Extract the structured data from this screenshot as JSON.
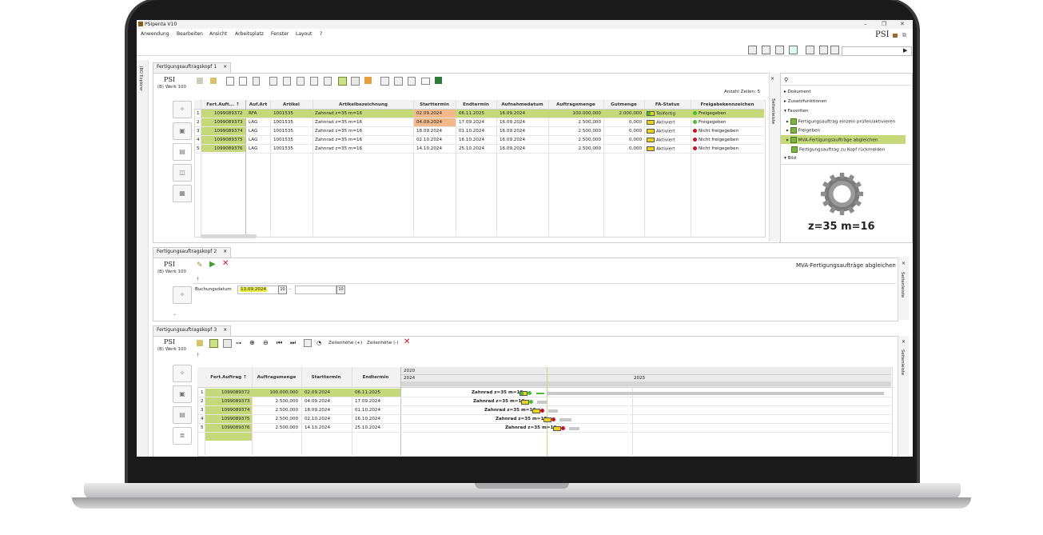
{
  "app": {
    "title": "PSIpenta V10",
    "logo": "PSI",
    "menu": [
      "Anwendung",
      "Bearbeiten",
      "Ansicht",
      "Arbeitsplatz",
      "Fenster",
      "Layout",
      "?"
    ],
    "ibo_label": "IBO Explorer"
  },
  "panel1": {
    "tab": "Fertigungsauftragskopf 1",
    "tab_close": "×",
    "psi": "PSI",
    "werk": "(B) Werk 100",
    "row_count": "Anzahl Zeilen: 5",
    "columns": [
      "Fert.Auft...",
      "Auf.Art",
      "Artikel",
      "Artikelbezeichnung",
      "Starttermin",
      "Endtermin",
      "Aufnahmedatum",
      "Auftragsmenge",
      "Gutmenge",
      "FA-Status",
      "Freigabekennzeichen"
    ],
    "sort_arrow": "↑",
    "rows": [
      {
        "n": "1",
        "auftrag": "1099089372",
        "art": "RFA",
        "artikel": "1001535",
        "bez": "Zahnrad z=35 m=16",
        "start": "02.09.2024",
        "ende": "06.11.2025",
        "aufnahme": "16.09.2024",
        "menge": "100.000,000",
        "gut": "2.000,000",
        "status": "Teilfertig",
        "freigabe": "Freigegeben",
        "freigabe_color": "green"
      },
      {
        "n": "2",
        "auftrag": "1099089373",
        "art": "LAG",
        "artikel": "1001535",
        "bez": "Zahnrad z=35 m=16",
        "start": "04.09.2024",
        "ende": "17.09.2024",
        "aufnahme": "16.09.2024",
        "menge": "2.500,000",
        "gut": "0,000",
        "status": "Aktiviert",
        "freigabe": "Freigegeben",
        "freigabe_color": "green"
      },
      {
        "n": "3",
        "auftrag": "1099089374",
        "art": "LAG",
        "artikel": "1001535",
        "bez": "Zahnrad z=35 m=16",
        "start": "18.09.2024",
        "ende": "01.10.2024",
        "aufnahme": "16.09.2024",
        "menge": "2.500,000",
        "gut": "0,000",
        "status": "Aktiviert",
        "freigabe": "Nicht freigegeben",
        "freigabe_color": "red"
      },
      {
        "n": "4",
        "auftrag": "1099089375",
        "art": "LAG",
        "artikel": "1001535",
        "bez": "Zahnrad z=35 m=16",
        "start": "02.10.2024",
        "ende": "16.10.2024",
        "aufnahme": "16.09.2024",
        "menge": "2.500,000",
        "gut": "0,000",
        "status": "Aktiviert",
        "freigabe": "Nicht freigegeben",
        "freigabe_color": "red"
      },
      {
        "n": "5",
        "auftrag": "1099089376",
        "art": "LAG",
        "artikel": "1001535",
        "bez": "Zahnrad z=35 m=16",
        "start": "14.10.2024",
        "ende": "25.10.2024",
        "aufnahme": "16.09.2024",
        "menge": "2.500,000",
        "gut": "0,000",
        "status": "Aktiviert",
        "freigabe": "Nicht freigegeben",
        "freigabe_color": "red"
      }
    ]
  },
  "sidebar": {
    "vertical_label": "Seitenleiste",
    "close": "×",
    "sections": {
      "dokument": "Dokument",
      "zusatz": "Zusatzfunktionen",
      "favoriten": "Favoriten",
      "bild": "Bild"
    },
    "favorites": [
      "Fertigungsauftrag einzeln prüfen/aktivieren",
      "Freigeben",
      "MVA-Fertigungsaufträge abgleichen",
      "Fertigungsauftrag zu Kopf rückmelden"
    ],
    "image_caption": "z=35 m=16"
  },
  "panel2": {
    "tab": "Fertigungsauftragskopf 2",
    "tab_close": "×",
    "psi": "PSI",
    "werk": "(B) Werk 100",
    "title": "MVA-Fertigungsaufträge abgleichen",
    "field_label": "Buchungsdatum",
    "date_from": "13.09.2024",
    "date_sep": "-",
    "date_to": "",
    "cal_icon": "10",
    "sidebar_label": "Seitenleiste"
  },
  "panel3": {
    "tab": "Fertigungsauftragskopf 3",
    "tab_close": "×",
    "psi": "PSI",
    "werk": "(B) Werk 100",
    "zeilen_plus": "Zeilenhöhe (+)",
    "zeilen_minus": "Zeilenhöhe (-)",
    "columns": [
      "Fert.Auftrag",
      "Auftragsmenge",
      "Starttermin",
      "Endtermin"
    ],
    "sort_arrow": "↑",
    "years_top": "2020",
    "years": [
      "2024",
      "2025"
    ],
    "sidebar_label": "Seitenleiste",
    "rows": [
      {
        "n": "1",
        "auftrag": "1099089372",
        "menge": "100.000,000",
        "start": "02.09.2024",
        "ende": "06.11.2025",
        "label": "Zahnrad z=35 m=16"
      },
      {
        "n": "2",
        "auftrag": "1099089373",
        "menge": "2.500,000",
        "start": "04.09.2024",
        "ende": "17.09.2024",
        "label": "Zahnrad z=35 m=16"
      },
      {
        "n": "3",
        "auftrag": "1099089374",
        "menge": "2.500,000",
        "start": "18.09.2024",
        "ende": "01.10.2024",
        "label": "Zahnrad z=35 m=16"
      },
      {
        "n": "4",
        "auftrag": "1099089375",
        "menge": "2.500,000",
        "start": "02.10.2024",
        "ende": "16.10.2024",
        "label": "Zahnrad z=35 m=16"
      },
      {
        "n": "5",
        "auftrag": "1099089376",
        "menge": "2.500,000",
        "start": "14.10.2024",
        "ende": "25.10.2024",
        "label": "Zahnrad z=35 m=16"
      }
    ]
  },
  "colors": {
    "accent_green": "#c5d97a",
    "highlight_orange": "#f3b98b",
    "status_green": "#4bbf2b",
    "status_red": "#c8121f"
  }
}
